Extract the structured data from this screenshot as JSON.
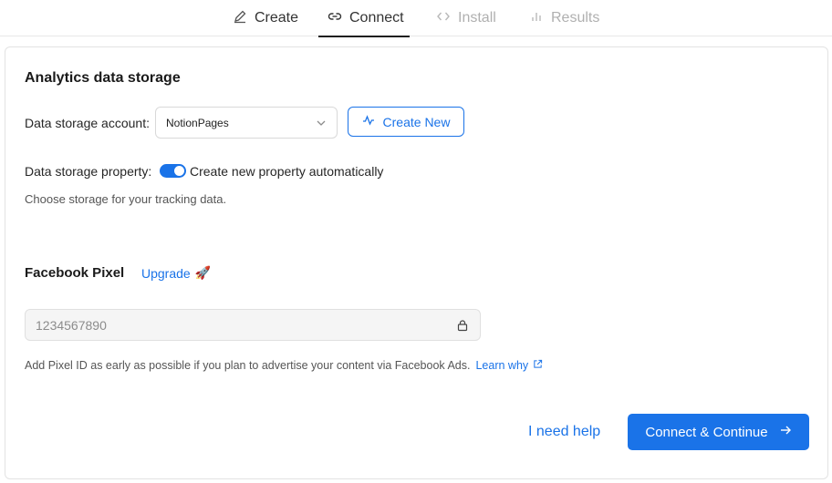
{
  "tabs": [
    {
      "label": "Create",
      "icon": "pencil-icon",
      "state": "default"
    },
    {
      "label": "Connect",
      "icon": "link-icon",
      "state": "active"
    },
    {
      "label": "Install",
      "icon": "code-icon",
      "state": "disabled"
    },
    {
      "label": "Results",
      "icon": "bar-chart-icon",
      "state": "disabled"
    }
  ],
  "analytics": {
    "title": "Analytics data storage",
    "account_label": "Data storage account:",
    "account_value": "NotionPages",
    "create_new_label": "Create New",
    "property_label": "Data storage property:",
    "toggle_on": true,
    "toggle_text": "Create new property automatically",
    "hint": "Choose storage for your tracking data."
  },
  "facebook": {
    "title": "Facebook Pixel",
    "upgrade_label": "Upgrade",
    "upgrade_emoji": "🚀",
    "pixel_placeholder": "1234567890",
    "hint": "Add Pixel ID as early as possible if you plan to advertise your content via Facebook Ads.",
    "learn_label": "Learn why"
  },
  "actions": {
    "help_label": "I need help",
    "continue_label": "Connect & Continue"
  },
  "colors": {
    "accent": "#1a73e8",
    "text": "#1f1f1f",
    "disabled": "#b0b0b0"
  }
}
